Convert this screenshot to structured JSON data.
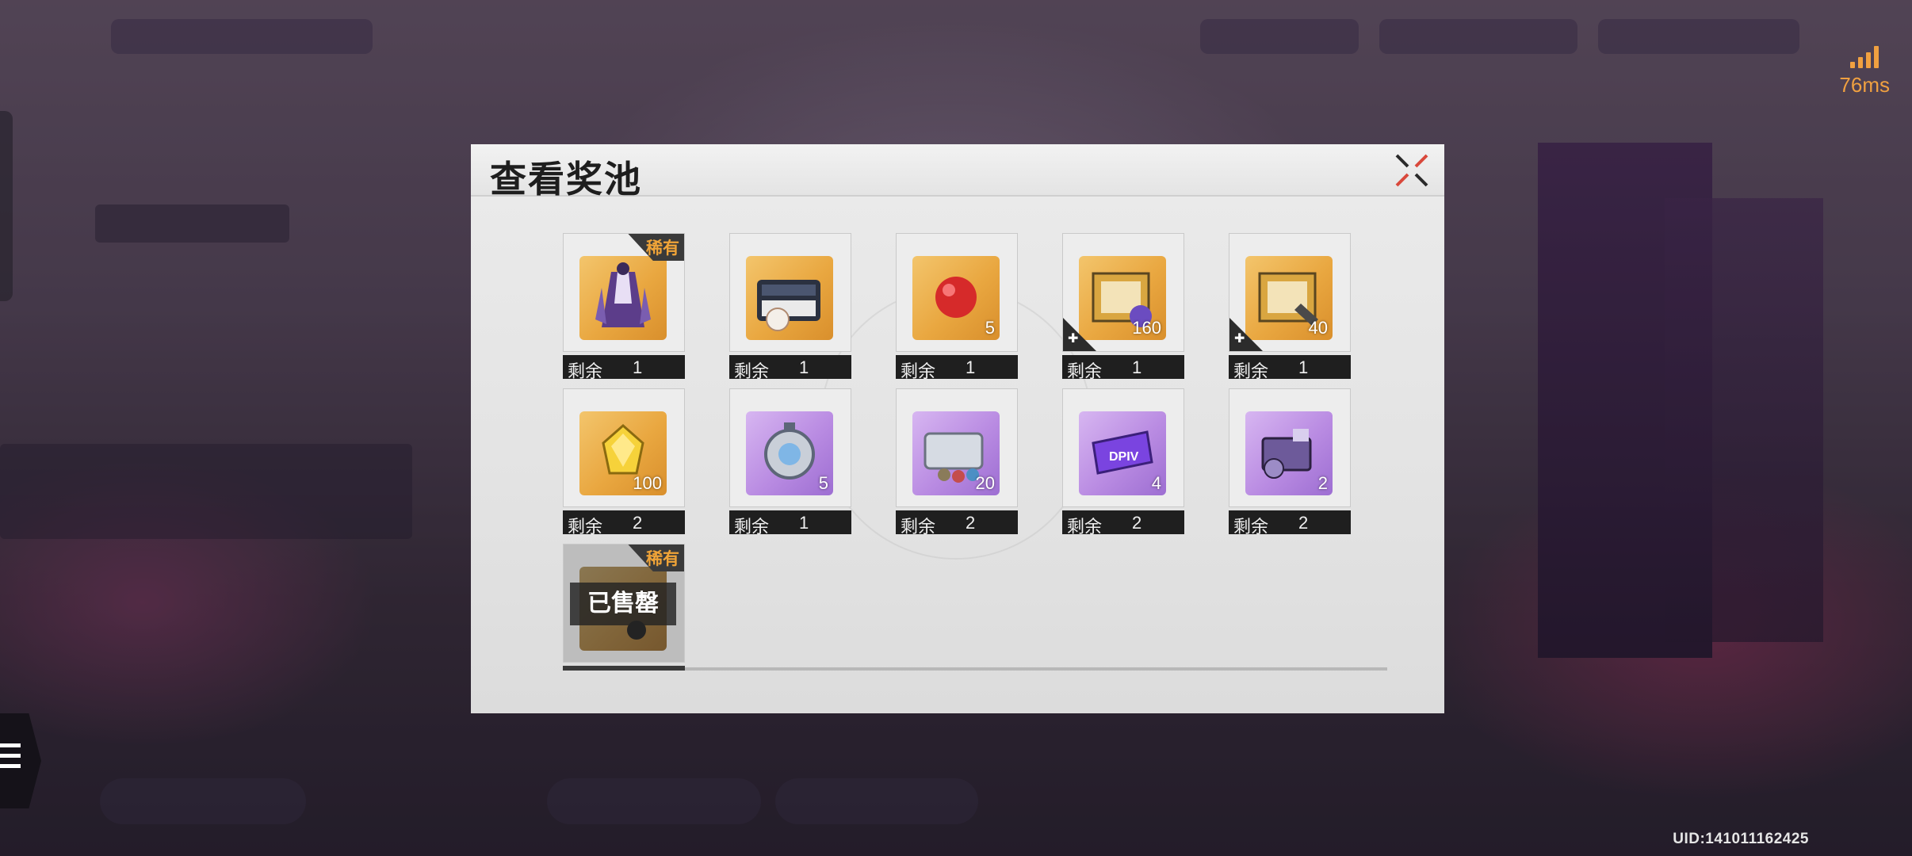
{
  "status": {
    "ping": "76ms",
    "uid": "UID:141011162425"
  },
  "dialog": {
    "title": "查看奖池"
  },
  "labels": {
    "remaining": "剩余",
    "rare": "稀有",
    "sold_out": "已售罄"
  },
  "items": [
    {
      "name": "costume",
      "count": "",
      "remaining": "1",
      "rare": true
    },
    {
      "name": "storage-case",
      "count": "",
      "remaining": "1"
    },
    {
      "name": "red-sphere",
      "count": "5",
      "remaining": "1"
    },
    {
      "name": "weapon-crate-fragment",
      "count": "160",
      "remaining": "1"
    },
    {
      "name": "weapon-crate-fragment",
      "count": "40",
      "remaining": "1"
    },
    {
      "name": "gold-crystal",
      "count": "100",
      "remaining": "2"
    },
    {
      "name": "core-chip",
      "count": "5",
      "remaining": "1"
    },
    {
      "name": "supply-box",
      "count": "20",
      "remaining": "2"
    },
    {
      "name": "dpiv-card",
      "count": "4",
      "remaining": "2"
    },
    {
      "name": "gear-module",
      "count": "2",
      "remaining": "2"
    },
    {
      "name": "rare-item-sold",
      "count": "",
      "remaining": "",
      "rare": true,
      "sold_out": true
    }
  ],
  "colors": {
    "rare": "#f0a438",
    "ping": "#f0a040"
  }
}
